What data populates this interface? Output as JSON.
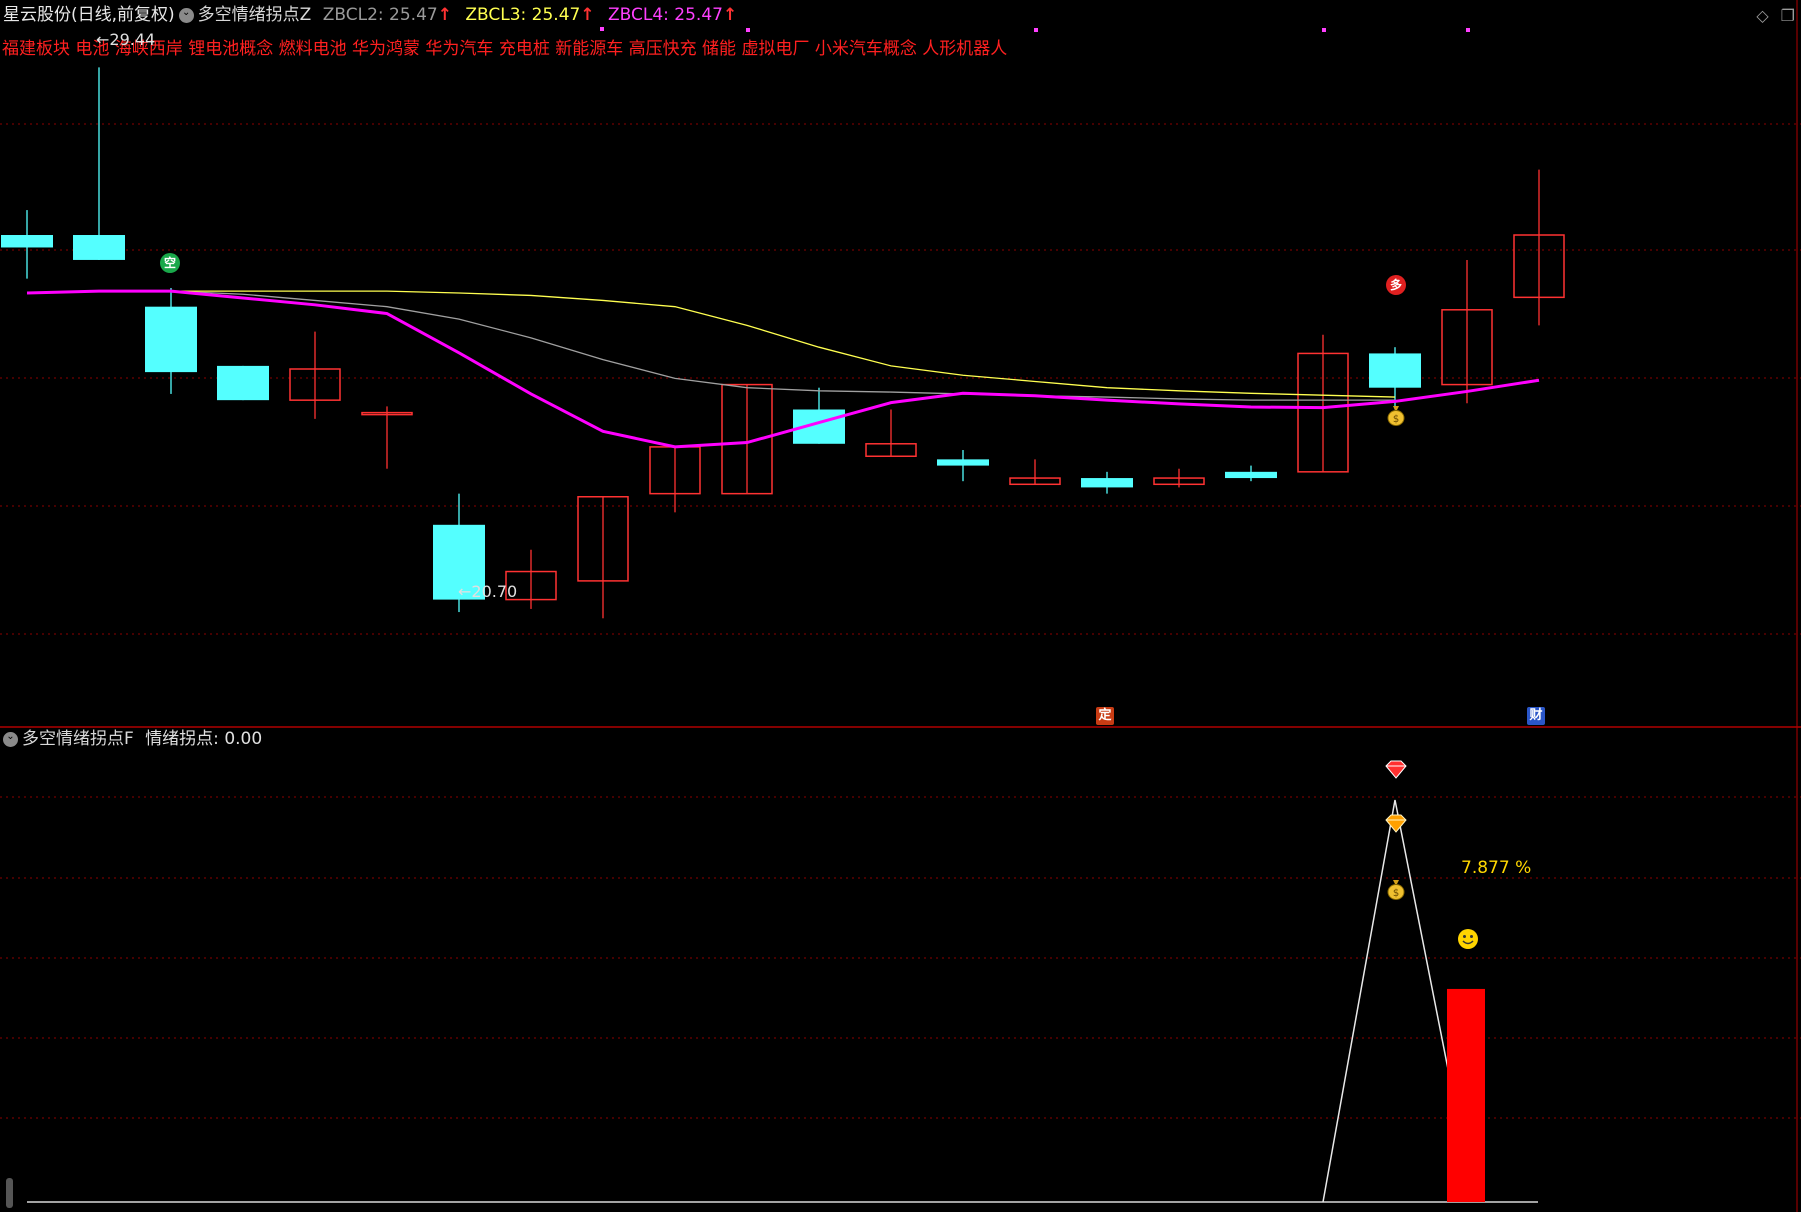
{
  "header": {
    "stock_title": "星云股份(日线,前复权)",
    "indicator_name": "多空情绪拐点Z",
    "zbcl2": "ZBCL2: 25.47",
    "zbcl3": "ZBCL3: 25.47",
    "zbcl4": "ZBCL4: 25.47",
    "arrow": "↑",
    "concepts": "福建板块 电池 海峡西岸 锂电池概念 燃料电池 华为鸿蒙 华为汽车 充电桩 新能源车 高压快充 储能 虚拟电厂 小米汽车概念 人形机器人"
  },
  "lower_panel": {
    "indicator_name": "多空情绪拐点F",
    "value_label": "情绪拐点: 0.00",
    "percent_label": "7.877 %"
  },
  "markers": {
    "high_label": "29.44",
    "low_label": "20.70",
    "kong": "空",
    "duo": "多",
    "ding": "定",
    "cai": "财",
    "money_icon": "money-bag-icon",
    "diamond_icon": "diamond-icon",
    "smile_icon": "smile-icon"
  },
  "colors": {
    "up": "#ff3232",
    "down": "#54ffff",
    "ma_magenta": "#ff00ff",
    "ma_yellow": "#ffff50",
    "ma_gray": "#a0a0a0",
    "grid": "#8b0000",
    "separator": "#b00000"
  },
  "chart_data": {
    "type": "candlestick",
    "candles": [
      {
        "o": 26.75,
        "h": 27.15,
        "l": 26.05,
        "c": 26.55
      },
      {
        "o": 26.75,
        "h": 29.44,
        "l": 26.35,
        "c": 26.35
      },
      {
        "o": 25.6,
        "h": 25.9,
        "l": 24.2,
        "c": 24.55
      },
      {
        "o": 24.65,
        "h": 24.65,
        "l": 24.6,
        "c": 24.1
      },
      {
        "o": 24.1,
        "h": 25.2,
        "l": 23.8,
        "c": 24.6
      },
      {
        "o": 23.9,
        "h": 24.0,
        "l": 23.0,
        "c": 23.9
      },
      {
        "o": 22.1,
        "h": 22.6,
        "l": 20.7,
        "c": 20.9
      },
      {
        "o": 20.9,
        "h": 21.7,
        "l": 20.75,
        "c": 21.35
      },
      {
        "o": 21.2,
        "h": 22.4,
        "l": 20.6,
        "c": 22.55
      },
      {
        "o": 22.6,
        "h": 22.0,
        "l": 22.3,
        "c": 23.35
      },
      {
        "o": 22.6,
        "h": 23.9,
        "l": 22.6,
        "c": 24.35
      },
      {
        "o": 23.95,
        "h": 24.3,
        "l": 23.5,
        "c": 23.4
      },
      {
        "o": 23.2,
        "h": 23.95,
        "l": 23.2,
        "c": 23.4
      },
      {
        "o": 23.15,
        "h": 23.3,
        "l": 22.8,
        "c": 23.05
      },
      {
        "o": 22.75,
        "h": 23.15,
        "l": 22.75,
        "c": 22.85
      },
      {
        "o": 22.85,
        "h": 22.95,
        "l": 22.6,
        "c": 22.7
      },
      {
        "o": 22.75,
        "h": 23.0,
        "l": 22.7,
        "c": 22.85
      },
      {
        "o": 22.95,
        "h": 23.05,
        "l": 22.8,
        "c": 22.85
      },
      {
        "o": 22.95,
        "h": 25.15,
        "l": 22.95,
        "c": 24.85
      },
      {
        "o": 24.85,
        "h": 24.95,
        "l": 23.95,
        "c": 24.3
      },
      {
        "o": 24.35,
        "h": 26.35,
        "l": 24.05,
        "c": 25.55
      },
      {
        "o": 25.75,
        "h": 27.8,
        "l": 25.3,
        "c": 26.75
      }
    ],
    "ma_magenta": [
      25.82,
      25.85,
      25.85,
      25.74,
      25.63,
      25.49,
      24.86,
      24.2,
      23.6,
      23.35,
      23.42,
      23.74,
      24.06,
      24.21,
      24.17,
      24.1,
      24.04,
      23.99,
      23.98,
      24.08,
      24.24,
      24.42
    ],
    "ma_yellow": [
      null,
      null,
      25.85,
      25.85,
      25.85,
      25.85,
      25.82,
      25.78,
      25.7,
      25.6,
      25.3,
      24.95,
      24.65,
      24.5,
      24.4,
      24.3,
      24.25,
      24.21,
      24.18,
      24.15,
      null,
      null
    ],
    "ma_gray": [
      null,
      null,
      25.85,
      25.8,
      25.7,
      25.6,
      25.4,
      25.1,
      24.75,
      24.45,
      24.3,
      24.25,
      24.23,
      24.2,
      24.17,
      24.15,
      24.12,
      24.1,
      24.1,
      24.1,
      null,
      null
    ],
    "lower_line": [
      0,
      0,
      0,
      0,
      0,
      0,
      0,
      0,
      0,
      0,
      0,
      0,
      0,
      0,
      0,
      0,
      0,
      0,
      0,
      100,
      28,
      null
    ],
    "lower_bar_index": 20,
    "lower_bar_value": 53
  }
}
